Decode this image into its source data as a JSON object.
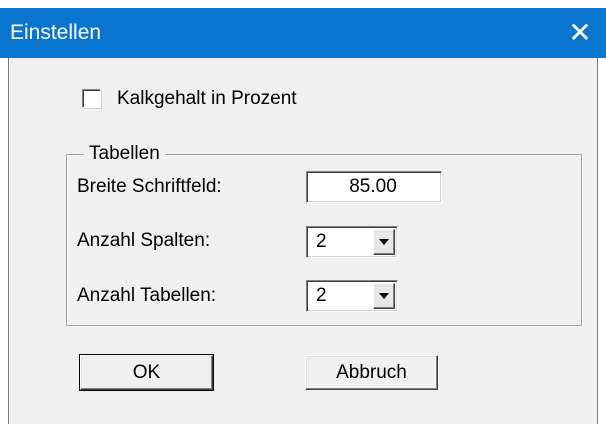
{
  "window": {
    "title": "Einstellen",
    "close_glyph": "✕",
    "titlebar_color": "#0a75cf"
  },
  "checkbox": {
    "label": "Kalkgehalt in Prozent",
    "checked": false
  },
  "group": {
    "label": "Tabellen",
    "breite_label": "Breite Schriftfeld:",
    "breite_value": "85.00",
    "spalten_label": "Anzahl Spalten:",
    "spalten_value": "2",
    "tabellen_label": "Anzahl Tabellen:",
    "tabellen_value": "2"
  },
  "buttons": {
    "ok": "OK",
    "cancel": "Abbruch"
  },
  "icons": {
    "close": "close-icon",
    "dropdown": "chevron-down-icon"
  }
}
